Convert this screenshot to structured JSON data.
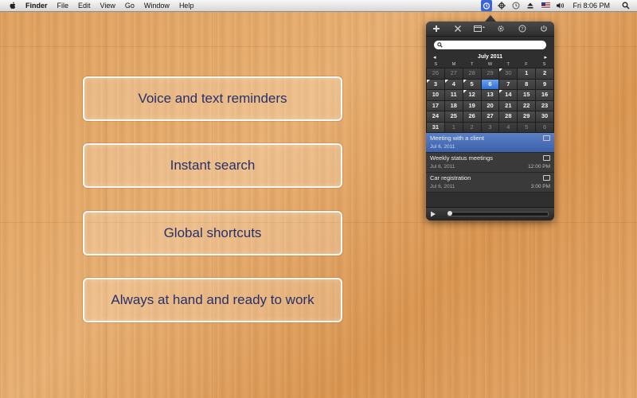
{
  "menubar": {
    "app_name": "Finder",
    "items": [
      "File",
      "Edit",
      "View",
      "Go",
      "Window",
      "Help"
    ],
    "clock": "Fri 8:06 PM"
  },
  "features": [
    "Voice and text reminders",
    "Instant search",
    "Global shortcuts",
    "Always at hand and ready to work"
  ],
  "calendar": {
    "prev": "◂",
    "next": "▸",
    "month": "July 2011",
    "weekdays": [
      "S",
      "M",
      "T",
      "W",
      "T",
      "F",
      "S"
    ],
    "days": [
      {
        "n": "26",
        "dim": true
      },
      {
        "n": "27",
        "dim": true
      },
      {
        "n": "28",
        "dim": true
      },
      {
        "n": "29",
        "dim": true
      },
      {
        "n": "30",
        "dim": true,
        "mark": true
      },
      {
        "n": "1"
      },
      {
        "n": "2"
      },
      {
        "n": "3",
        "mark": true
      },
      {
        "n": "4",
        "mark": true
      },
      {
        "n": "5",
        "mark": true
      },
      {
        "n": "6",
        "today": true
      },
      {
        "n": "7"
      },
      {
        "n": "8"
      },
      {
        "n": "9"
      },
      {
        "n": "10"
      },
      {
        "n": "11"
      },
      {
        "n": "12",
        "mark": true
      },
      {
        "n": "13"
      },
      {
        "n": "14",
        "mark": true
      },
      {
        "n": "15"
      },
      {
        "n": "16"
      },
      {
        "n": "17"
      },
      {
        "n": "18"
      },
      {
        "n": "19"
      },
      {
        "n": "20"
      },
      {
        "n": "21"
      },
      {
        "n": "22"
      },
      {
        "n": "23"
      },
      {
        "n": "24"
      },
      {
        "n": "25"
      },
      {
        "n": "26"
      },
      {
        "n": "27"
      },
      {
        "n": "28"
      },
      {
        "n": "29"
      },
      {
        "n": "30"
      },
      {
        "n": "31"
      },
      {
        "n": "1",
        "dim": true
      },
      {
        "n": "2",
        "dim": true
      },
      {
        "n": "3",
        "dim": true
      },
      {
        "n": "4",
        "dim": true
      },
      {
        "n": "5",
        "dim": true
      },
      {
        "n": "6",
        "dim": true
      }
    ]
  },
  "events": [
    {
      "title": "Meeting with a client",
      "date": "Jul 6, 2011",
      "time": "",
      "selected": true
    },
    {
      "title": "Weekly status meetings",
      "date": "Jul 6, 2011",
      "time": "12:00 PM",
      "selected": false
    },
    {
      "title": "Car registration",
      "date": "Jul 6, 2011",
      "time": "3:00 PM",
      "selected": false
    }
  ],
  "colors": {
    "accent": "#3b63d6",
    "today": "#2f6fd9",
    "feature_text": "#27306b"
  }
}
